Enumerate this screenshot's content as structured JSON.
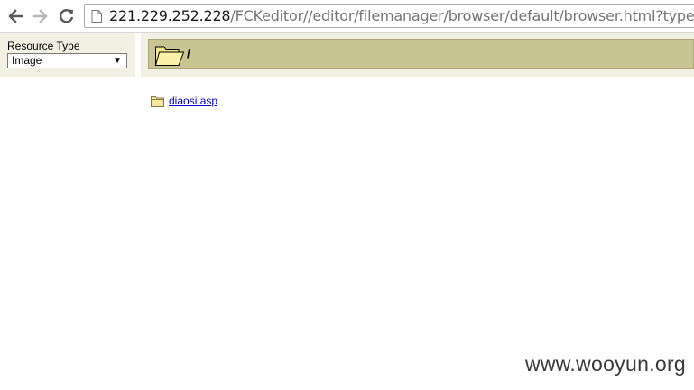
{
  "browser": {
    "url_host": "221.229.252.228",
    "url_path": "/FCKeditor//editor/filemanager/browser/default/browser.html?type="
  },
  "left_panel": {
    "resource_type_label": "Resource Type",
    "resource_type_selected": "Image"
  },
  "header": {
    "current_path": "/"
  },
  "listing": {
    "items": [
      {
        "name": "diaosi.asp",
        "icon": "folder-icon"
      }
    ]
  },
  "watermark": "www.wooyun.org",
  "colors": {
    "panel_bg": "#f1f1e3",
    "folder_bar": "#c9c592",
    "link": "#0000cc"
  }
}
